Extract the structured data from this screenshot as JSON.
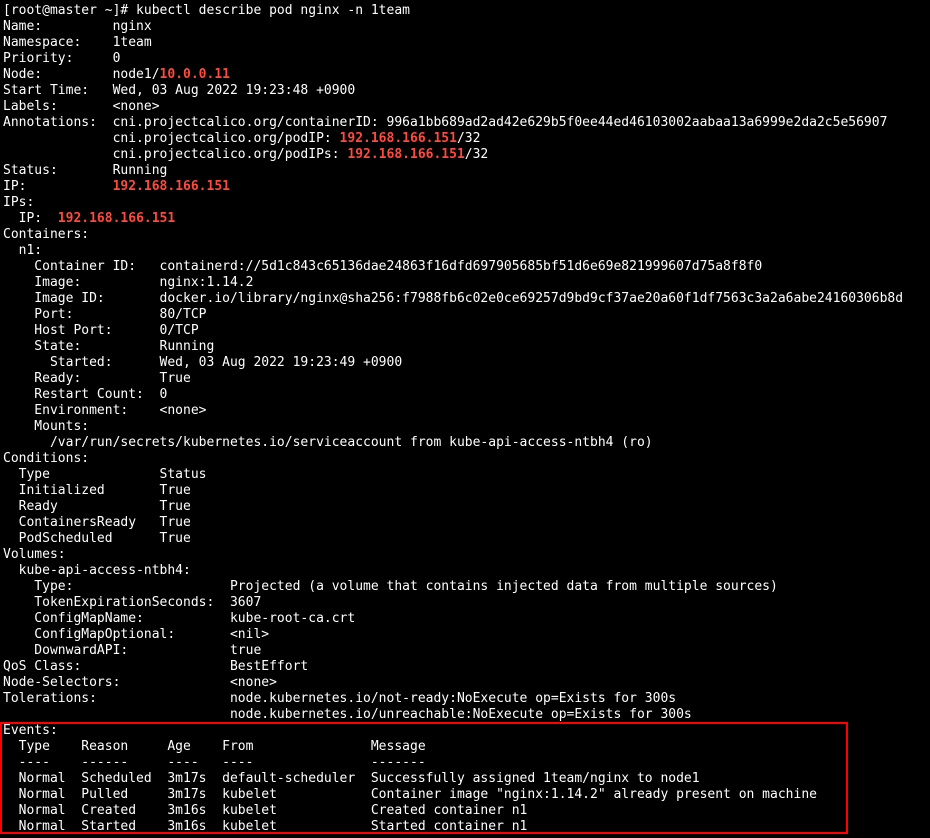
{
  "terminal": {
    "lines": [
      [
        {
          "t": "[root@master ~]# kubectl describe pod nginx -n 1team"
        }
      ],
      [
        {
          "t": "Name:         nginx"
        }
      ],
      [
        {
          "t": "Namespace:    1team"
        }
      ],
      [
        {
          "t": "Priority:     0"
        }
      ],
      [
        {
          "t": "Node:         node1/"
        },
        {
          "t": "10.0.0.11",
          "hl": true
        }
      ],
      [
        {
          "t": "Start Time:   Wed, 03 Aug 2022 19:23:48 +0900"
        }
      ],
      [
        {
          "t": "Labels:       <none>"
        }
      ],
      [
        {
          "t": "Annotations:  cni.projectcalico.org/containerID: 996a1bb689ad2ad42e629b5f0ee44ed46103002aabaa13a6999e2da2c5e56907"
        }
      ],
      [
        {
          "t": "              cni.projectcalico.org/podIP: "
        },
        {
          "t": "192.168.166.151",
          "hl": true
        },
        {
          "t": "/32"
        }
      ],
      [
        {
          "t": "              cni.projectcalico.org/podIPs: "
        },
        {
          "t": "192.168.166.151",
          "hl": true
        },
        {
          "t": "/32"
        }
      ],
      [
        {
          "t": "Status:       Running"
        }
      ],
      [
        {
          "t": "IP:           "
        },
        {
          "t": "192.168.166.151",
          "hl": true
        }
      ],
      [
        {
          "t": "IPs:"
        }
      ],
      [
        {
          "t": "  IP:  "
        },
        {
          "t": "192.168.166.151",
          "hl": true
        }
      ],
      [
        {
          "t": "Containers:"
        }
      ],
      [
        {
          "t": "  n1:"
        }
      ],
      [
        {
          "t": "    Container ID:   containerd://5d1c843c65136dae24863f16dfd697905685bf51d6e69e821999607d75a8f8f0"
        }
      ],
      [
        {
          "t": "    Image:          nginx:1.14.2"
        }
      ],
      [
        {
          "t": "    Image ID:       docker.io/library/nginx@sha256:f7988fb6c02e0ce69257d9bd9cf37ae20a60f1df7563c3a2a6abe24160306b8d"
        }
      ],
      [
        {
          "t": "    Port:           80/TCP"
        }
      ],
      [
        {
          "t": "    Host Port:      0/TCP"
        }
      ],
      [
        {
          "t": "    State:          Running"
        }
      ],
      [
        {
          "t": "      Started:      Wed, 03 Aug 2022 19:23:49 +0900"
        }
      ],
      [
        {
          "t": "    Ready:          True"
        }
      ],
      [
        {
          "t": "    Restart Count:  0"
        }
      ],
      [
        {
          "t": "    Environment:    <none>"
        }
      ],
      [
        {
          "t": "    Mounts:"
        }
      ],
      [
        {
          "t": "      /var/run/secrets/kubernetes.io/serviceaccount from kube-api-access-ntbh4 (ro)"
        }
      ],
      [
        {
          "t": "Conditions:"
        }
      ],
      [
        {
          "t": "  Type              Status"
        }
      ],
      [
        {
          "t": "  Initialized       True"
        }
      ],
      [
        {
          "t": "  Ready             True"
        }
      ],
      [
        {
          "t": "  ContainersReady   True"
        }
      ],
      [
        {
          "t": "  PodScheduled      True"
        }
      ],
      [
        {
          "t": "Volumes:"
        }
      ],
      [
        {
          "t": "  kube-api-access-ntbh4:"
        }
      ],
      [
        {
          "t": "    Type:                    Projected (a volume that contains injected data from multiple sources)"
        }
      ],
      [
        {
          "t": "    TokenExpirationSeconds:  3607"
        }
      ],
      [
        {
          "t": "    ConfigMapName:           kube-root-ca.crt"
        }
      ],
      [
        {
          "t": "    ConfigMapOptional:       <nil>"
        }
      ],
      [
        {
          "t": "    DownwardAPI:             true"
        }
      ],
      [
        {
          "t": "QoS Class:                   BestEffort"
        }
      ],
      [
        {
          "t": "Node-Selectors:              <none>"
        }
      ],
      [
        {
          "t": "Tolerations:                 node.kubernetes.io/not-ready:NoExecute op=Exists for 300s"
        }
      ],
      [
        {
          "t": "                             node.kubernetes.io/unreachable:NoExecute op=Exists for 300s"
        }
      ],
      [
        {
          "t": "Events:"
        }
      ],
      [
        {
          "t": "  Type    Reason     Age    From               Message"
        }
      ],
      [
        {
          "t": "  ----    ------     ----   ----               -------"
        }
      ],
      [
        {
          "t": "  Normal  Scheduled  3m17s  default-scheduler  Successfully assigned 1team/nginx to node1"
        }
      ],
      [
        {
          "t": "  Normal  Pulled     3m17s  kubelet            Container image \"nginx:1.14.2\" already present on machine"
        }
      ],
      [
        {
          "t": "  Normal  Created    3m16s  kubelet            Created container n1"
        }
      ],
      [
        {
          "t": "  Normal  Started    3m16s  kubelet            Started container n1"
        }
      ]
    ]
  },
  "colors": {
    "background": "#000000",
    "text": "#ffffff",
    "highlight_text": "#ff4a3d",
    "annotation_box": "#ff0000"
  }
}
